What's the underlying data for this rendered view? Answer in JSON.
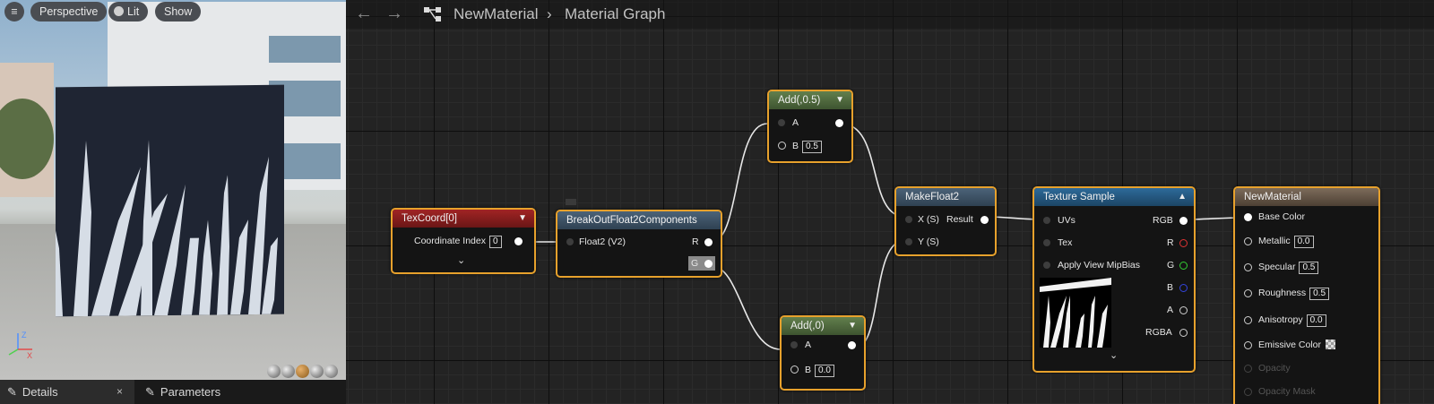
{
  "viewport": {
    "menu_icon": "hamburger-icon",
    "perspective_label": "Perspective",
    "lit_label": "Lit",
    "show_label": "Show",
    "axis": {
      "x": "X",
      "z": "Z"
    }
  },
  "panel_tabs": {
    "details_label": "Details",
    "details_close": "×",
    "parameters_label": "Parameters"
  },
  "graph_header": {
    "back_icon": "←",
    "forward_icon": "→",
    "material_name": "NewMaterial",
    "separator": "›",
    "graph_name": "Material Graph"
  },
  "nodes": {
    "texcoord": {
      "title": "TexCoord[0]",
      "param_label": "Coordinate Index",
      "param_value": "0",
      "color": "#8a1d1d"
    },
    "break": {
      "title": "BreakOutFloat2Components",
      "input": "Float2 (V2)",
      "out_r": "R",
      "out_g": "G",
      "color": "#3d5266"
    },
    "add_top": {
      "title": "Add(,0.5)",
      "in_a": "A",
      "in_b": "B",
      "b_value": "0.5",
      "color": "#4f6a3f"
    },
    "add_bottom": {
      "title": "Add(,0)",
      "in_a": "A",
      "in_b": "B",
      "b_value": "0.0",
      "color": "#4f6a3f"
    },
    "makefloat": {
      "title": "MakeFloat2",
      "in_x": "X (S)",
      "in_y": "Y (S)",
      "out": "Result",
      "color": "#3d5266"
    },
    "texsample": {
      "title": "Texture Sample",
      "uvs": "UVs",
      "tex": "Tex",
      "mipbias": "Apply View MipBias",
      "rgb": "RGB",
      "r": "R",
      "g": "G",
      "b": "B",
      "a": "A",
      "rgba": "RGBA",
      "color": "#27557a"
    },
    "material": {
      "title": "NewMaterial",
      "color": "#6b5a4a",
      "inputs": [
        {
          "label": "Base Color",
          "value": ""
        },
        {
          "label": "Metallic",
          "value": "0.0"
        },
        {
          "label": "Specular",
          "value": "0.5"
        },
        {
          "label": "Roughness",
          "value": "0.5"
        },
        {
          "label": "Anisotropy",
          "value": "0.0"
        },
        {
          "label": "Emissive Color",
          "value": ""
        },
        {
          "label": "Opacity",
          "value": ""
        },
        {
          "label": "Opacity Mask",
          "value": ""
        }
      ]
    }
  }
}
